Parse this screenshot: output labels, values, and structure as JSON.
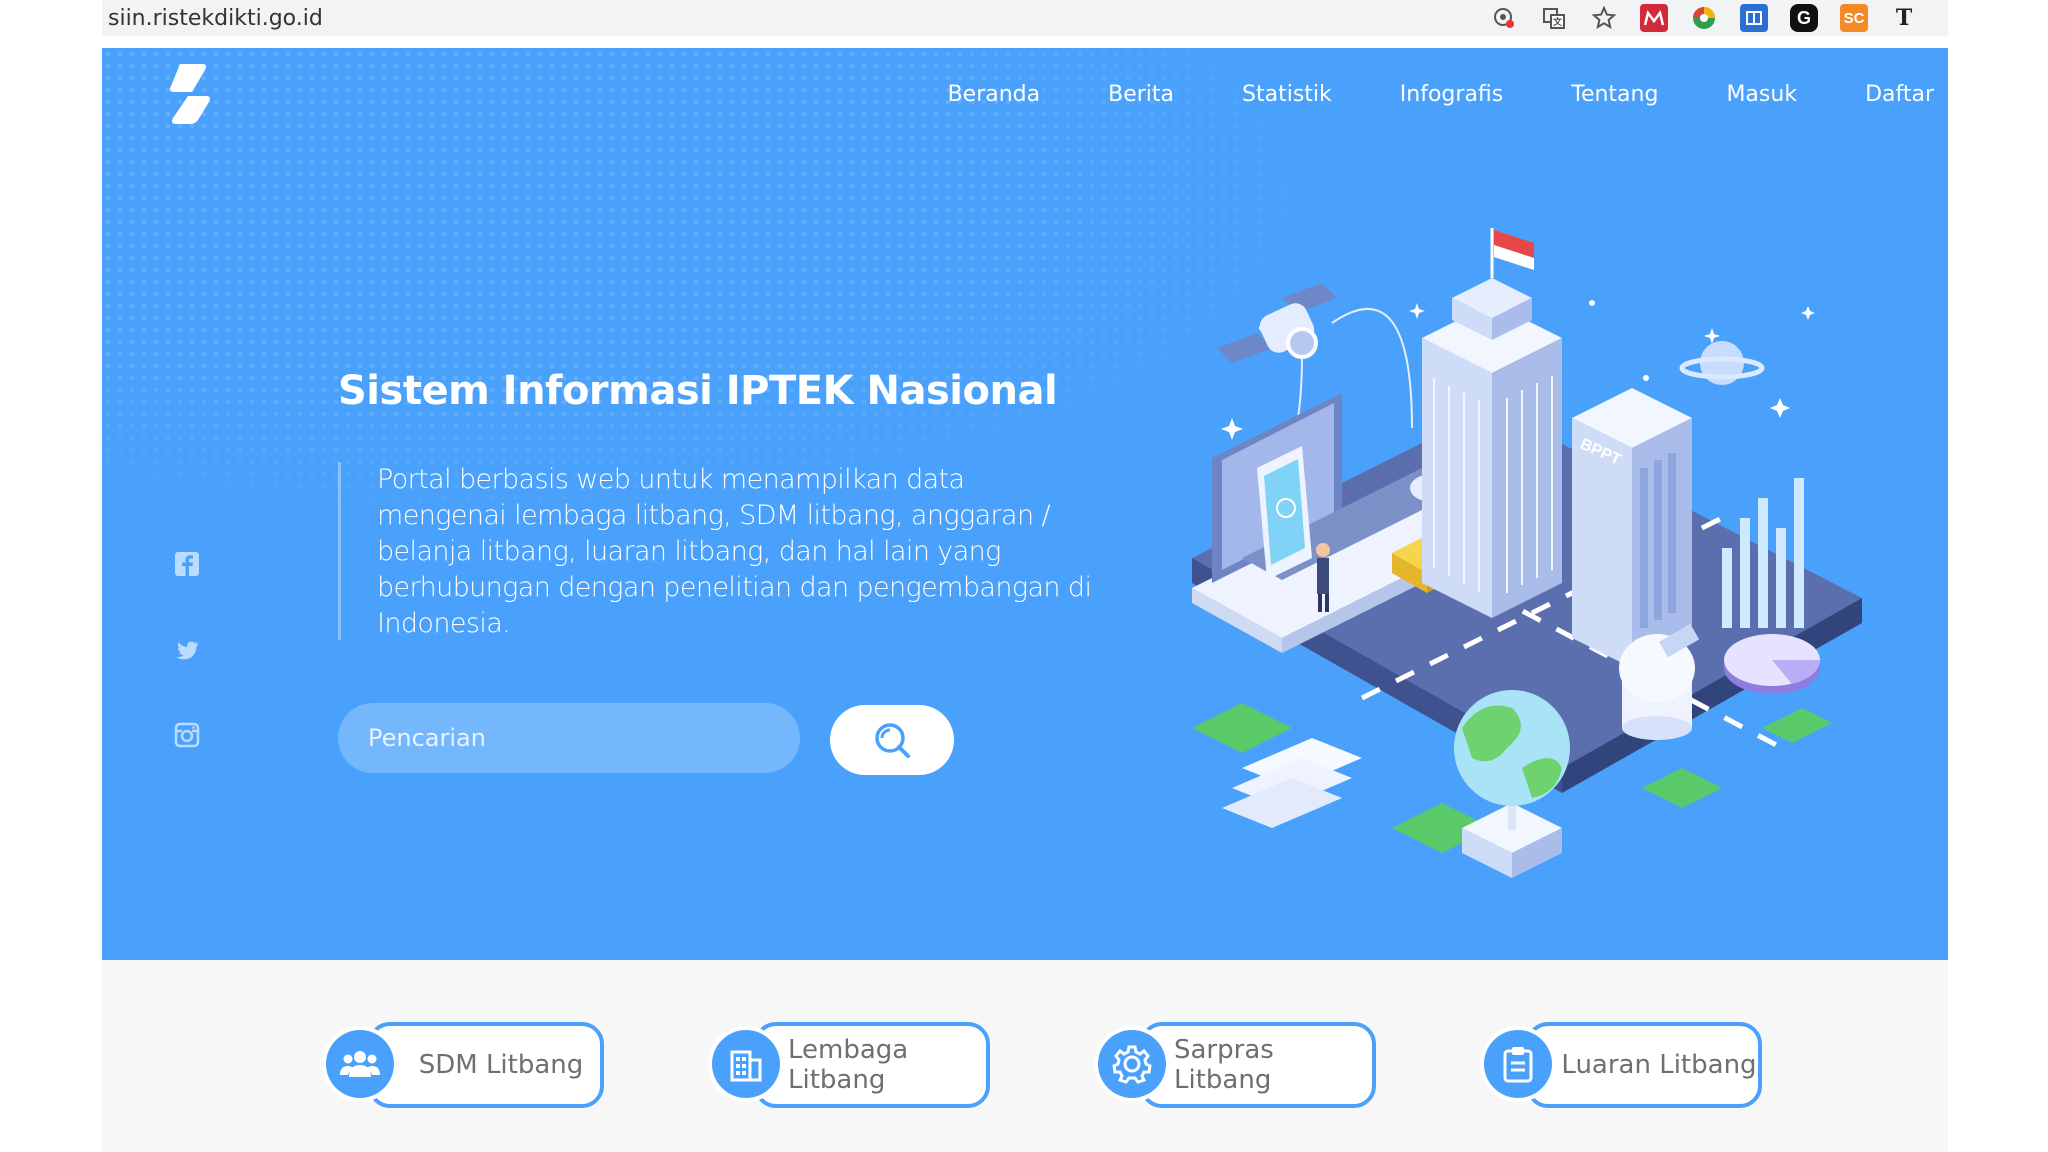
{
  "browser": {
    "url": "siin.ristekdikti.go.id",
    "extensions": [
      "location-icon",
      "translate-icon",
      "star-icon",
      "mendeley-icon",
      "chrome-ext-icon",
      "reader-icon",
      "grammarly-icon",
      "sc-icon",
      "typography-icon"
    ],
    "ext_labels": {
      "sc": "SC",
      "t": "T",
      "g": "G"
    }
  },
  "header": {
    "nav": [
      "Beranda",
      "Berita",
      "Statistik",
      "Infografis",
      "Tentang",
      "Masuk",
      "Daftar"
    ]
  },
  "hero": {
    "title": "Sistem Informasi IPTEK Nasional",
    "description": "Portal berbasis web untuk menampilkan data mengenai lembaga litbang, SDM litbang, anggaran / belanja litbang, luaran litbang, dan hal lain yang berhubungan dengan penelitian dan pengembangan di Indonesia.",
    "search_placeholder": "Pencarian",
    "illustration_sign": "BPPT"
  },
  "categories": [
    {
      "label": "SDM Litbang",
      "icon": "people-icon"
    },
    {
      "label": "Lembaga Litbang",
      "icon": "building-icon"
    },
    {
      "label": "Sarpras Litbang",
      "icon": "gear-icon"
    },
    {
      "label": "Luaran Litbang",
      "icon": "clipboard-icon"
    }
  ],
  "colors": {
    "primary": "#4aa1fb",
    "white": "#ffffff"
  }
}
